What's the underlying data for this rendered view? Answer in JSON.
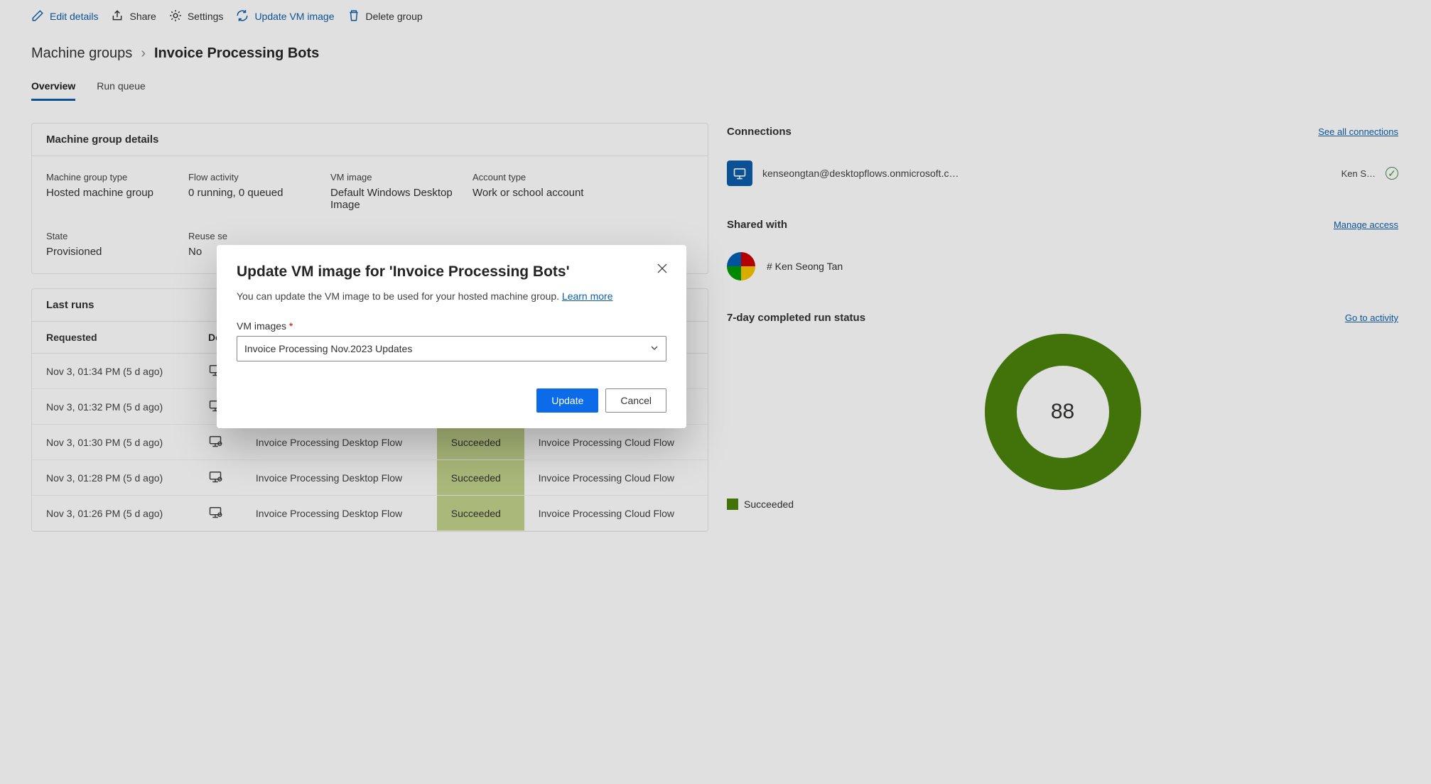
{
  "toolbar": {
    "edit": "Edit details",
    "share": "Share",
    "settings": "Settings",
    "update_vm": "Update VM image",
    "delete": "Delete group"
  },
  "breadcrumb": {
    "parent": "Machine groups",
    "current": "Invoice Processing Bots"
  },
  "tabs": {
    "overview": "Overview",
    "run_queue": "Run queue"
  },
  "details": {
    "header": "Machine group details",
    "type_label": "Machine group type",
    "type_value": "Hosted machine group",
    "activity_label": "Flow activity",
    "activity_value": "0 running, 0 queued",
    "vm_label": "VM image",
    "vm_value": "Default Windows Desktop Image",
    "account_label": "Account type",
    "account_value": "Work or school account",
    "state_label": "State",
    "state_value": "Provisioned",
    "reuse_label": "Reuse se",
    "reuse_value": "No"
  },
  "runs": {
    "header": "Last runs",
    "columns": {
      "requested": "Requested",
      "desktop": "Deskt",
      "status": "",
      "cloud": ""
    },
    "rows": [
      {
        "requested": "Nov 3, 01:34 PM (5 d ago)",
        "desktop": "",
        "status": "",
        "cloud": ""
      },
      {
        "requested": "Nov 3, 01:32 PM (5 d ago)",
        "desktop": "",
        "status": "",
        "cloud": ""
      },
      {
        "requested": "Nov 3, 01:30 PM (5 d ago)",
        "desktop": "Invoice Processing Desktop Flow",
        "status": "Succeeded",
        "cloud": "Invoice Processing Cloud Flow"
      },
      {
        "requested": "Nov 3, 01:28 PM (5 d ago)",
        "desktop": "Invoice Processing Desktop Flow",
        "status": "Succeeded",
        "cloud": "Invoice Processing Cloud Flow"
      },
      {
        "requested": "Nov 3, 01:26 PM (5 d ago)",
        "desktop": "Invoice Processing Desktop Flow",
        "status": "Succeeded",
        "cloud": "Invoice Processing Cloud Flow"
      }
    ]
  },
  "connections": {
    "header": "Connections",
    "see_all": "See all connections",
    "email": "kenseongtan@desktopflows.onmicrosoft.c…",
    "name": "Ken S…"
  },
  "shared": {
    "header": "Shared with",
    "manage": "Manage access",
    "name": "# Ken Seong Tan"
  },
  "status": {
    "header": "7-day completed run status",
    "go_to": "Go to activity",
    "count": "88",
    "legend": "Succeeded"
  },
  "modal": {
    "title": "Update VM image for 'Invoice Processing Bots'",
    "body": "You can update the VM image to be used for your hosted machine group. ",
    "learn_more": "Learn more",
    "field_label": "VM images ",
    "selected": "Invoice Processing Nov.2023 Updates",
    "update": "Update",
    "cancel": "Cancel"
  },
  "chart_data": {
    "type": "pie",
    "title": "7-day completed run status",
    "series": [
      {
        "name": "Succeeded",
        "values": [
          88
        ]
      }
    ],
    "categories": [
      "Succeeded"
    ],
    "values": [
      88
    ]
  }
}
